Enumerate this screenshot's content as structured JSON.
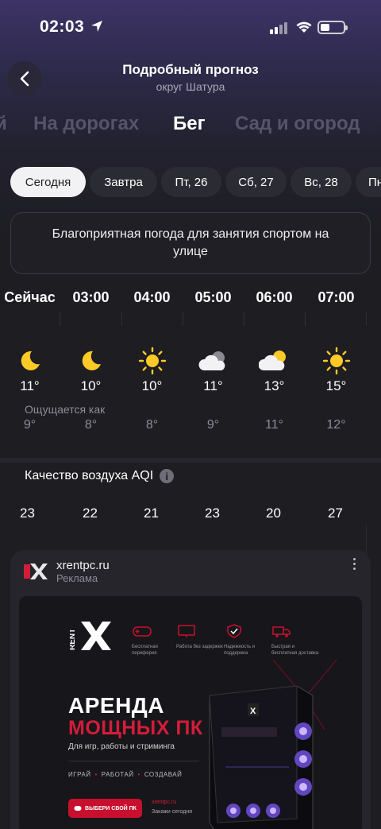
{
  "status_bar": {
    "time": "02:03"
  },
  "header": {
    "title": "Подробный прогноз",
    "subtitle": "округ Шатура"
  },
  "categories": [
    {
      "label": "й"
    },
    {
      "label": "На дорогах"
    },
    {
      "label": "Бег",
      "active": true
    },
    {
      "label": "Сад и огород"
    }
  ],
  "days": [
    {
      "label": "Сегодня",
      "active": true
    },
    {
      "label": "Завтра"
    },
    {
      "label": "Пт, 26"
    },
    {
      "label": "Сб, 27"
    },
    {
      "label": "Вс, 28"
    },
    {
      "label": "Пн"
    }
  ],
  "banner": {
    "text": "Благоприятная погода для занятия спортом на улице"
  },
  "hourly": {
    "feels_label": "Ощущается как",
    "items": [
      {
        "hour": "Сейчас",
        "icon": "moon-icon",
        "temp": "11°",
        "feels": "9°",
        "aqi": "23"
      },
      {
        "hour": "03:00",
        "icon": "moon-icon",
        "temp": "10°",
        "feels": "8°",
        "aqi": "22"
      },
      {
        "hour": "04:00",
        "icon": "sun-icon",
        "temp": "10°",
        "feels": "8°",
        "aqi": "21"
      },
      {
        "hour": "05:00",
        "icon": "cloudy-icon",
        "temp": "11°",
        "feels": "9°",
        "aqi": "23"
      },
      {
        "hour": "06:00",
        "icon": "partly-cloudy-icon",
        "temp": "13°",
        "feels": "11°",
        "aqi": "20"
      },
      {
        "hour": "07:00",
        "icon": "sun-icon",
        "temp": "15°",
        "feels": "12°",
        "aqi": "27"
      }
    ]
  },
  "aqi": {
    "title": "Качество воздуха AQI",
    "info_glyph": "i"
  },
  "ad": {
    "domain": "xrentpc.ru",
    "label": "Реклама",
    "brand_rent": "RENT",
    "brand_x": "X",
    "features": [
      {
        "text": "Бесплатная периферия",
        "icon": "gamepad-icon"
      },
      {
        "text": "Работа без задержек",
        "icon": "monitor-icon"
      },
      {
        "text": "Надежность и поддержка",
        "icon": "shield-check-icon"
      },
      {
        "text": "Быстрая и бесплатная доставка",
        "icon": "truck-icon"
      }
    ],
    "headline_1": "АРЕНДА",
    "headline_2": "МОЩНЫХ ПК",
    "subheadline": "Для игр, работы и стриминга",
    "tags": [
      "ИГРАЙ",
      "РАБОТАЙ",
      "СОЗДАВАЙ"
    ],
    "cta": "ВЫБЕРИ СВОЙ ПК",
    "site": "xrentpc.ru",
    "order_today": "Закажи сегодня"
  },
  "colors": {
    "accent_red": "#d21d3a",
    "sun_yellow": "#ffc928",
    "background": "#1d1d22"
  }
}
